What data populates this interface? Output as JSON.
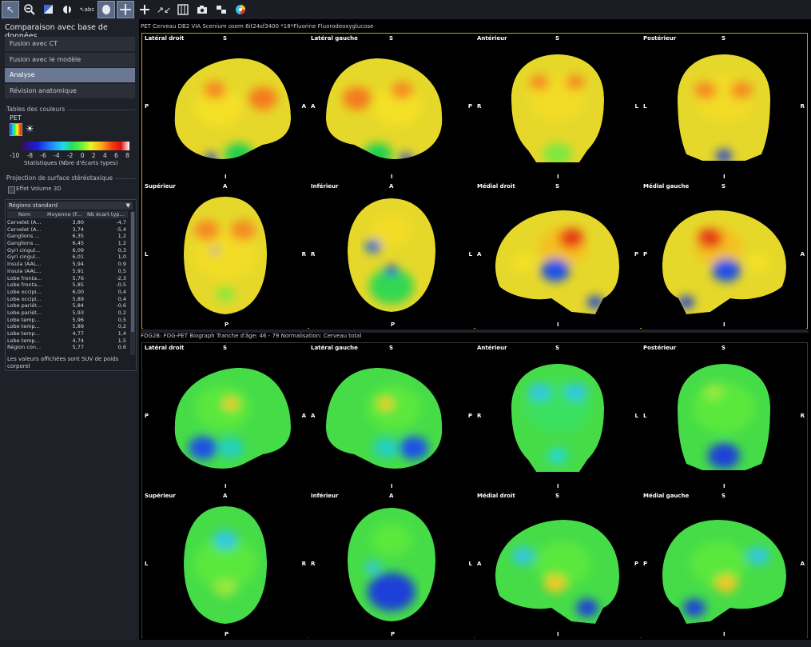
{
  "left_panel": {
    "title": "Comparaison avec base de données",
    "nav": [
      {
        "label": "Fusion avec CT",
        "selected": false
      },
      {
        "label": "Fusion avec le modèle",
        "selected": false
      },
      {
        "label": "Analyse",
        "selected": true
      },
      {
        "label": "Révision anatomique",
        "selected": false
      }
    ],
    "color_tables_title": "Tables des couleurs",
    "pet_label": "PET",
    "colorbar_ticks": [
      "-10",
      "-8",
      "-6",
      "-4",
      "-2",
      "0",
      "2",
      "4",
      "6",
      "8"
    ],
    "colorbar_caption": "Statistiques (Nbre d'écarts types)",
    "projection_title": "Projection de surface stéréotaxique",
    "effet_volume_label": "Effet Volume 3D",
    "regions_select": "Régions standard",
    "regions_columns": [
      "Nom",
      "Moyenne (F...",
      "Nb écart typ..."
    ],
    "regions_rows": [
      [
        "Cervelet (A...",
        "3,80",
        "-4,7"
      ],
      [
        "Cervelet (A...",
        "3,74",
        "-5,4"
      ],
      [
        "Ganglions ...",
        "6,35",
        "1,2"
      ],
      [
        "Ganglions ...",
        "6,45",
        "1,2"
      ],
      [
        "Gyri cingul...",
        "6,09",
        "0,3"
      ],
      [
        "Gyri cingul...",
        "6,01",
        "1,0"
      ],
      [
        "Insula (AAL...",
        "5,94",
        "0,9"
      ],
      [
        "Insula (AAL...",
        "5,91",
        "0,5"
      ],
      [
        "Lobe fronta...",
        "5,76",
        "-2,3"
      ],
      [
        "Lobe fronta...",
        "5,85",
        "-0,5"
      ],
      [
        "Lobe occipi...",
        "6,00",
        "0,4"
      ],
      [
        "Lobe occipi...",
        "5,89",
        "0,4"
      ],
      [
        "Lobe pariét...",
        "5,84",
        "-0,6"
      ],
      [
        "Lobe pariét...",
        "5,93",
        "0,2"
      ],
      [
        "Lobe temp...",
        "5,96",
        "0,5"
      ],
      [
        "Lobe temp...",
        "5,89",
        "0,2"
      ],
      [
        "Lobe temp...",
        "4,77",
        "1,4"
      ],
      [
        "Lobe temp...",
        "4,74",
        "1,5"
      ],
      [
        "Région con...",
        "5,77",
        "0,6"
      ]
    ],
    "regions_note": "Les valeurs affichées sont SUV de poids corporel"
  },
  "top_view": {
    "header": "PET Cerveau DB2 VIA Scenium osem 6it24sf3400      *18*Fluorine  Fluorodeoxyglucose"
  },
  "bottom_view": {
    "header": "FDG2B: FDG-PET Biograph     Tranche d'âge: 46 - 79     Normalisation: Cerveau total"
  },
  "cell_titles": [
    "Latéral droit",
    "Latéral gauche",
    "Antérieur",
    "Postérieur",
    "Supérieur",
    "Inférieur",
    "Médial droit",
    "Médial gauche"
  ],
  "orient": [
    {
      "t": "S",
      "b": "I",
      "l": "P",
      "r": "A"
    },
    {
      "t": "S",
      "b": "I",
      "l": "A",
      "r": "P"
    },
    {
      "t": "S",
      "b": "I",
      "l": "R",
      "r": "L"
    },
    {
      "t": "S",
      "b": "I",
      "l": "L",
      "r": "R"
    },
    {
      "t": "A",
      "b": "P",
      "l": "L",
      "r": "R"
    },
    {
      "t": "A",
      "b": "P",
      "l": "R",
      "r": "L"
    },
    {
      "t": "S",
      "b": "I",
      "l": "A",
      "r": "P"
    },
    {
      "t": "S",
      "b": "I",
      "l": "P",
      "r": "A"
    }
  ],
  "colors": {
    "top_grid_border": "#c8962e",
    "selected_nav": "#6b7894"
  }
}
